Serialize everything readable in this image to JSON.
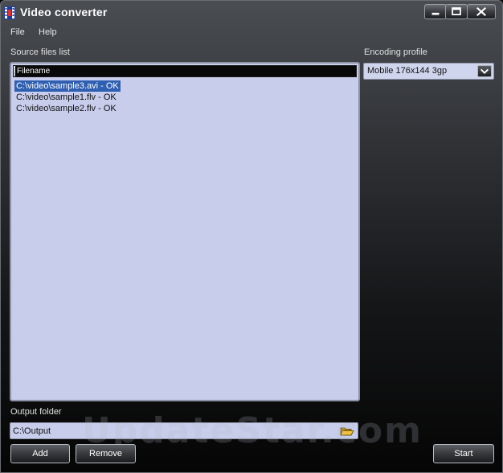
{
  "window": {
    "title": "Video converter",
    "icon": "film-strip-icon"
  },
  "caption_buttons": {
    "minimize": "minimize-icon",
    "maximize": "maximize-icon",
    "close": "close-icon"
  },
  "menu": {
    "items": [
      "File",
      "Help"
    ]
  },
  "source_files": {
    "label": "Source files list",
    "column_header": "Filename",
    "rows": [
      "C:\\video\\sample3.avi - OK",
      "C:\\video\\sample1.flv - OK",
      "C:\\video\\sample2.flv - OK"
    ],
    "selected_index": 0
  },
  "encoding_profile": {
    "label": "Encoding profile",
    "selected": "Mobile 176x144 3gp"
  },
  "output_folder": {
    "label": "Output folder",
    "value": "C:\\Output",
    "icon": "folder-open-icon"
  },
  "buttons": {
    "add": "Add",
    "remove": "Remove",
    "start": "Start"
  },
  "watermark": "UpdateStar.com",
  "colors": {
    "list_background": "#c7cdea",
    "selection": "#2f5fb0"
  }
}
